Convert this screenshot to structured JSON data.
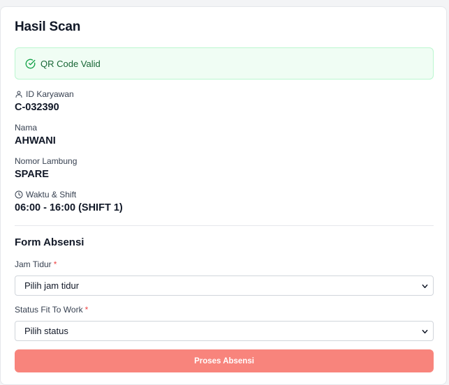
{
  "card": {
    "title": "Hasil Scan",
    "alert": {
      "text": "QR Code Valid",
      "icon": "check-circle-icon",
      "color": "#166534"
    },
    "fields": {
      "id_karyawan": {
        "label": "ID Karyawan",
        "value": "C-032390",
        "icon": "user-icon"
      },
      "nama": {
        "label": "Nama",
        "value": "AHWANI"
      },
      "nomor_lambung": {
        "label": "Nomor Lambung",
        "value": "SPARE"
      },
      "waktu_shift": {
        "label": "Waktu & Shift",
        "value": "06:00 - 16:00 (SHIFT 1)",
        "icon": "clock-icon"
      }
    }
  },
  "form": {
    "title": "Form Absensi",
    "jam_tidur": {
      "label": "Jam Tidur",
      "required_mark": "*",
      "selected": "Pilih jam tidur"
    },
    "status_ftw": {
      "label": "Status Fit To Work",
      "required_mark": "*",
      "selected": "Pilih status"
    },
    "submit_label": "Proses Absensi",
    "submit_color": "#f8847c"
  }
}
